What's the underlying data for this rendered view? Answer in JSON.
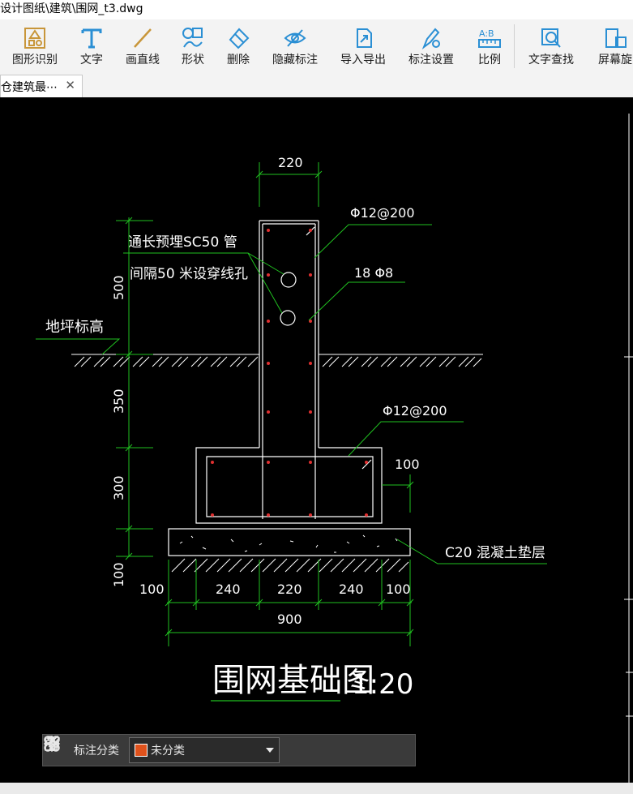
{
  "window": {
    "title": "设计图纸\\建筑\\围网_t3.dwg"
  },
  "toolbar": {
    "items": [
      {
        "label": "图形识别",
        "icon": "shape-recognize-icon"
      },
      {
        "label": "文字",
        "icon": "text-icon"
      },
      {
        "label": "画直线",
        "icon": "line-icon"
      },
      {
        "label": "形状",
        "icon": "shapes-icon"
      },
      {
        "label": "删除",
        "icon": "eraser-icon"
      },
      {
        "label": "隐藏标注",
        "icon": "eye-hide-icon"
      },
      {
        "label": "导入导出",
        "icon": "import-export-icon"
      },
      {
        "label": "标注设置",
        "icon": "annotation-settings-icon"
      },
      {
        "label": "比例",
        "icon": "scale-icon"
      },
      {
        "label": "文字查找",
        "icon": "text-search-icon"
      },
      {
        "label": "屏幕旋",
        "icon": "screen-rotate-icon"
      }
    ]
  },
  "tab": {
    "label": "仓建筑最⋯",
    "close": "✕"
  },
  "drawing": {
    "dim_top": "220",
    "rebar_top": "Φ12@200",
    "note_line1": "通长预埋SC50  管",
    "note_line2": "间隔50  米设穿线孔",
    "rebar_mid": "18  Φ8",
    "ground_label": "地坪标高",
    "rebar_base": "Φ12@200",
    "dim_right_100": "100",
    "layer_label": "C20  混凝土垫层",
    "dim_left_500": "500",
    "dim_left_350": "350",
    "dim_left_300": "300",
    "dim_left_100": "100",
    "dims_bottom": [
      "100",
      "240",
      "220",
      "240",
      "100"
    ],
    "dim_total": "900",
    "title": "围网基础图",
    "scale": "1:20"
  },
  "annotation_bar": {
    "label": "标注分类",
    "dropdown_value": "未分类",
    "swatch_color": "#e0521c"
  }
}
